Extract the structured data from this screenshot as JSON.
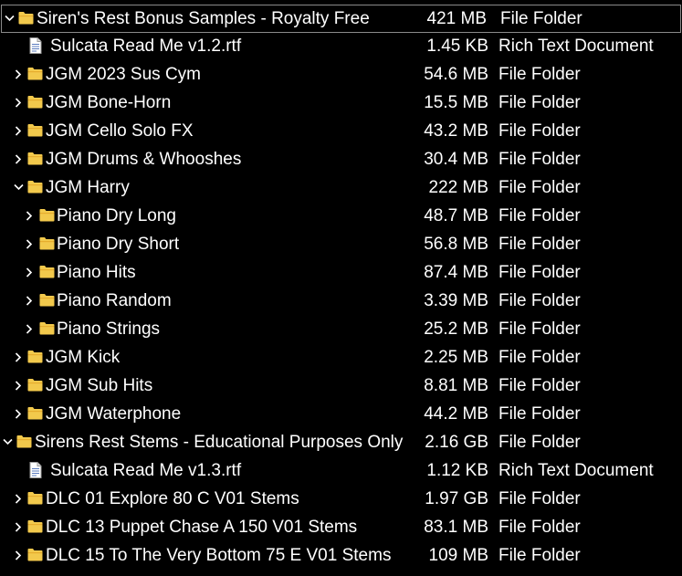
{
  "colors": {
    "background": "#000000",
    "text": "#ffffff",
    "folder": "#f2c94c",
    "selection_border": "#8a8a8a"
  },
  "rows": [
    {
      "name": "Siren's Rest Bonus Samples - Royalty Free",
      "size": "421 MB",
      "type": "File Folder",
      "icon": "folder-icon",
      "expander": "chevron-down-icon"
    },
    {
      "name": "Sulcata Read Me v1.2.rtf",
      "size": "1.45 KB",
      "type": "Rich Text Document",
      "icon": "document-icon"
    },
    {
      "name": "JGM 2023 Sus Cym",
      "size": "54.6 MB",
      "type": "File Folder",
      "icon": "folder-icon",
      "expander": "chevron-right-icon"
    },
    {
      "name": "JGM Bone-Horn",
      "size": "15.5 MB",
      "type": "File Folder",
      "icon": "folder-icon",
      "expander": "chevron-right-icon"
    },
    {
      "name": "JGM Cello Solo FX",
      "size": "43.2 MB",
      "type": "File Folder",
      "icon": "folder-icon",
      "expander": "chevron-right-icon"
    },
    {
      "name": "JGM Drums & Whooshes",
      "size": "30.4 MB",
      "type": "File Folder",
      "icon": "folder-icon",
      "expander": "chevron-right-icon"
    },
    {
      "name": "JGM Harry",
      "size": "222 MB",
      "type": "File Folder",
      "icon": "folder-icon",
      "expander": "chevron-down-icon"
    },
    {
      "name": "Piano Dry Long",
      "size": "48.7 MB",
      "type": "File Folder",
      "icon": "folder-icon",
      "expander": "chevron-right-icon"
    },
    {
      "name": "Piano Dry Short",
      "size": "56.8 MB",
      "type": "File Folder",
      "icon": "folder-icon",
      "expander": "chevron-right-icon"
    },
    {
      "name": "Piano Hits",
      "size": "87.4 MB",
      "type": "File Folder",
      "icon": "folder-icon",
      "expander": "chevron-right-icon"
    },
    {
      "name": "Piano Random",
      "size": "3.39 MB",
      "type": "File Folder",
      "icon": "folder-icon",
      "expander": "chevron-right-icon"
    },
    {
      "name": "Piano Strings",
      "size": "25.2 MB",
      "type": "File Folder",
      "icon": "folder-icon",
      "expander": "chevron-right-icon"
    },
    {
      "name": "JGM Kick",
      "size": "2.25 MB",
      "type": "File Folder",
      "icon": "folder-icon",
      "expander": "chevron-right-icon"
    },
    {
      "name": "JGM Sub Hits",
      "size": "8.81 MB",
      "type": "File Folder",
      "icon": "folder-icon",
      "expander": "chevron-right-icon"
    },
    {
      "name": "JGM Waterphone",
      "size": "44.2 MB",
      "type": "File Folder",
      "icon": "folder-icon",
      "expander": "chevron-right-icon"
    },
    {
      "name": "Sirens Rest Stems - Educational Purposes Only",
      "size": "2.16 GB",
      "type": "File Folder",
      "icon": "folder-icon",
      "expander": "chevron-down-icon"
    },
    {
      "name": "Sulcata Read Me v1.3.rtf",
      "size": "1.12 KB",
      "type": "Rich Text Document",
      "icon": "document-icon"
    },
    {
      "name": "DLC 01 Explore 80 C V01 Stems",
      "size": "1.97 GB",
      "type": "File Folder",
      "icon": "folder-icon",
      "expander": "chevron-right-icon"
    },
    {
      "name": "DLC 13 Puppet Chase A 150 V01 Stems",
      "size": "83.1 MB",
      "type": "File Folder",
      "icon": "folder-icon",
      "expander": "chevron-right-icon"
    },
    {
      "name": "DLC 15 To The Very Bottom 75 E V01 Stems",
      "size": "109 MB",
      "type": "File Folder",
      "icon": "folder-icon",
      "expander": "chevron-right-icon"
    }
  ]
}
